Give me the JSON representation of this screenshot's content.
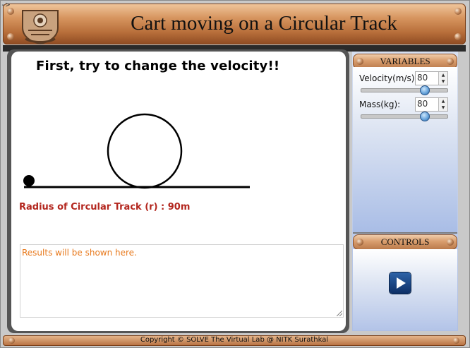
{
  "header": {
    "title": "Cart moving on a Circular Track",
    "logo_icon": "institute-emblem-icon",
    "corner_glyph": "->"
  },
  "stage": {
    "instruction": "First, try to change the velocity!!",
    "radius_label": "Radius of Circular Track (r) : 90m",
    "results_text": "Results will be shown here."
  },
  "variables": {
    "title": "VARIABLES",
    "velocity": {
      "label": "Velocity(m/s):",
      "value": "80",
      "slider_fraction": 0.75
    },
    "mass": {
      "label": "Mass(kg):",
      "value": "80",
      "slider_fraction": 0.75
    }
  },
  "controls": {
    "title": "CONTROLS",
    "play_icon": "play-icon"
  },
  "footer": {
    "copyright": "Copyright © SOLVE The Virtual Lab @ NITK Surathkal"
  },
  "colors": {
    "header_accent": "#b86f3b",
    "radius_text": "#b3261e",
    "results_text": "#e87a1e",
    "panel_blue": "#aebfe4"
  }
}
